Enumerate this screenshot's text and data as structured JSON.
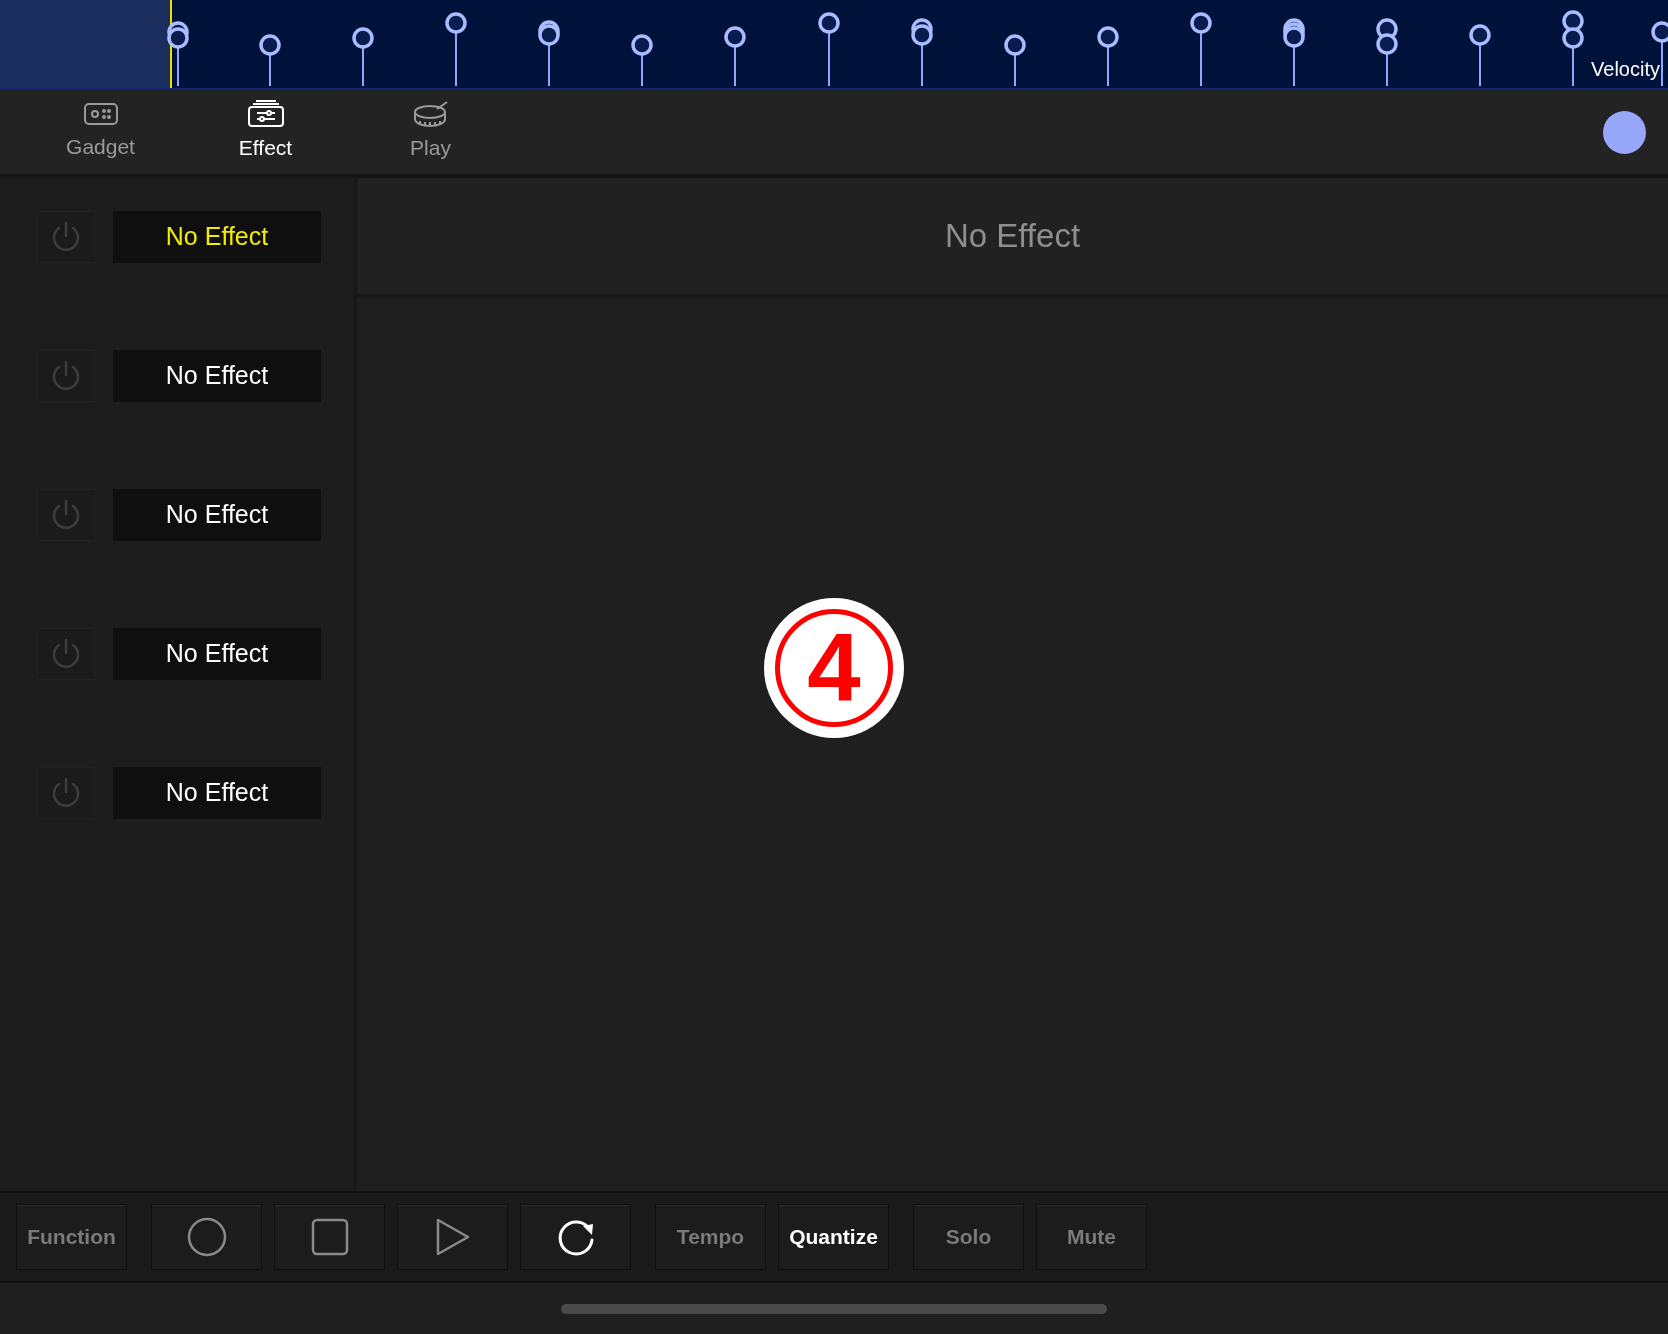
{
  "velocity_lane": {
    "label": "Velocity"
  },
  "tabs": [
    {
      "label": "Gadget",
      "kind": "gadget",
      "selected": false
    },
    {
      "label": "Effect",
      "kind": "effect",
      "selected": true
    },
    {
      "label": "Play",
      "kind": "drum",
      "selected": false
    }
  ],
  "effect_slots": [
    {
      "label": "No Effect",
      "selected": true
    },
    {
      "label": "No Effect",
      "selected": false
    },
    {
      "label": "No Effect",
      "selected": false
    },
    {
      "label": "No Effect",
      "selected": false
    },
    {
      "label": "No Effect",
      "selected": false
    }
  ],
  "effect_title": "No Effect",
  "step_marker": "4",
  "toolbar": [
    {
      "kind": "text",
      "label": "Function",
      "on": false
    },
    {
      "kind": "record",
      "on": false
    },
    {
      "kind": "stop",
      "on": false
    },
    {
      "kind": "play",
      "on": false
    },
    {
      "kind": "loop",
      "on": true
    },
    {
      "kind": "text",
      "label": "Tempo",
      "on": false
    },
    {
      "kind": "text",
      "label": "Quantize",
      "on": true
    },
    {
      "kind": "text",
      "label": "Solo",
      "on": false
    },
    {
      "kind": "text",
      "label": "Mute",
      "on": false
    }
  ]
}
